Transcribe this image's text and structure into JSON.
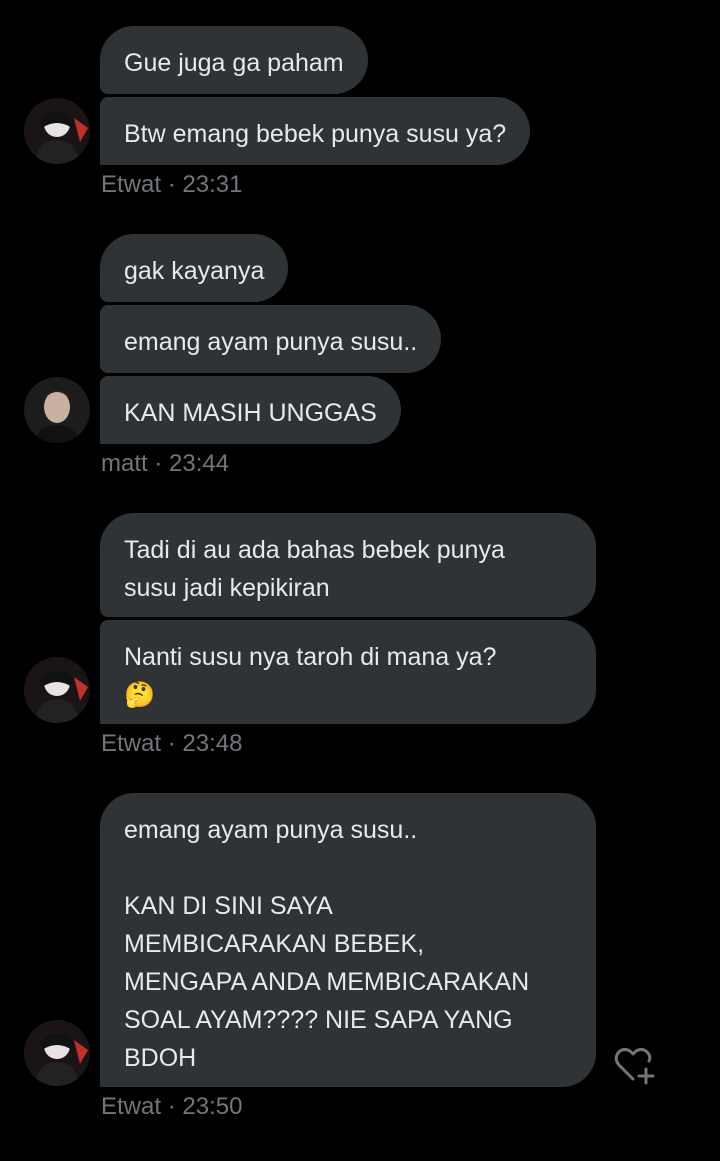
{
  "groups": [
    {
      "bubbles": [
        "Gue juga ga paham",
        "Btw emang bebek punya susu ya?"
      ],
      "sender": "Etwat",
      "time": "23:31",
      "avatar_icon": "avatar-dark-character-icon"
    },
    {
      "bubbles": [
        "gak kayanya",
        "emang ayam punya susu..",
        "KAN MASIH UNGGAS"
      ],
      "sender": "matt",
      "time": "23:44",
      "avatar_icon": "avatar-person-photo-icon"
    },
    {
      "bubbles": [
        "Tadi di au ada bahas bebek punya\nsusu jadi kepikiran",
        "Nanti susu nya taroh di mana ya?\n🤔"
      ],
      "sender": "Etwat",
      "time": "23:48",
      "avatar_icon": "avatar-dark-character-icon"
    },
    {
      "bubbles": [
        "emang ayam punya susu..\n\nKAN DI SINI SAYA\nMEMBICARAKAN BEBEK,\nMENGAPA ANDA MEMBICARAKAN\nSOAL AYAM???? NIE SAPA YANG\nBDOH"
      ],
      "sender": "Etwat",
      "time": "23:50",
      "avatar_icon": "avatar-dark-character-icon"
    }
  ],
  "meta_separator": "·",
  "colors": {
    "background": "#000000",
    "bubble": "#2f3336",
    "text": "#e7e9ea",
    "meta": "#71767b"
  }
}
